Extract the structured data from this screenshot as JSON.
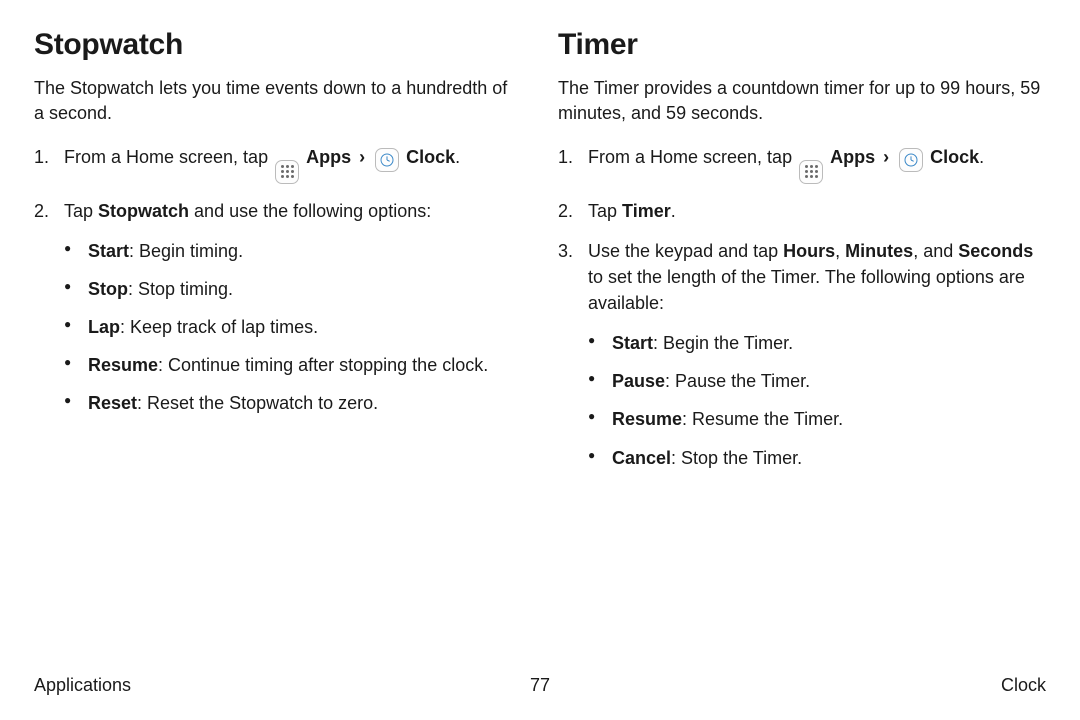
{
  "left": {
    "heading": "Stopwatch",
    "intro": "The Stopwatch lets you time events down to a hundredth of a second.",
    "step1_a": "From a Home screen, tap ",
    "apps_label": "Apps",
    "clock_label": "Clock",
    "period": ".",
    "step2_a": "Tap ",
    "step2_b": "Stopwatch",
    "step2_c": " and use the following options:",
    "opts": {
      "start_t": "Start",
      "start_d": ": Begin timing.",
      "stop_t": "Stop",
      "stop_d": ": Stop timing.",
      "lap_t": "Lap",
      "lap_d": ": Keep track of lap times.",
      "resume_t": "Resume",
      "resume_d": ": Continue timing after stopping the clock.",
      "reset_t": "Reset",
      "reset_d": ": Reset the Stopwatch to zero."
    }
  },
  "right": {
    "heading": "Timer",
    "intro": "The Timer provides a countdown timer for up to 99 hours, 59 minutes, and 59 seconds.",
    "step1_a": "From a Home screen, tap ",
    "apps_label": "Apps",
    "clock_label": "Clock",
    "period": ".",
    "step2_a": "Tap ",
    "step2_b": "Timer",
    "step2_c": ".",
    "step3_a": "Use the keypad and tap ",
    "step3_hours": "Hours",
    "step3_comma1": ", ",
    "step3_minutes": "Minutes",
    "step3_comma2": ", and ",
    "step3_seconds": "Seconds",
    "step3_b": " to set the length of the Timer. The following options are available:",
    "opts": {
      "start_t": "Start",
      "start_d": ": Begin the Timer.",
      "pause_t": "Pause",
      "pause_d": ": Pause the Timer.",
      "resume_t": "Resume",
      "resume_d": ": Resume the Timer.",
      "cancel_t": "Cancel",
      "cancel_d": ": Stop the Timer."
    }
  },
  "footer": {
    "left": "Applications",
    "center": "77",
    "right": "Clock"
  }
}
